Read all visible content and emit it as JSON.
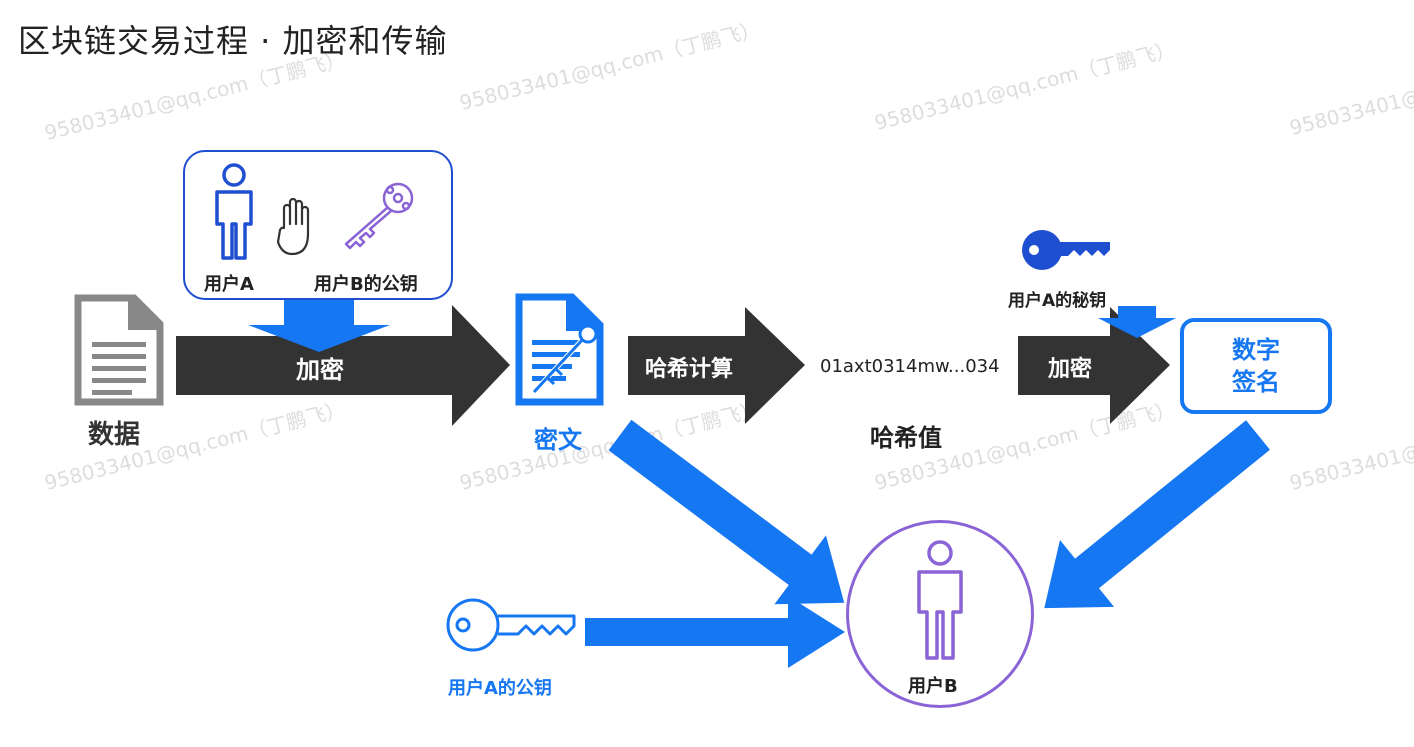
{
  "title": "区块链交易过程 · 加密和传输",
  "watermark": "958033401@qq.com（丁鹏飞）",
  "labels": {
    "data": "数据",
    "user_a": "用户A",
    "user_b_pubkey": "用户B的公钥",
    "encrypt_1": "加密",
    "ciphertext": "密文",
    "hash_calc": "哈希计算",
    "hash_text": "01axt0314mw...034",
    "hash_value": "哈希值",
    "user_a_privkey": "用户A的秘钥",
    "encrypt_2": "加密",
    "signature_line1": "数字",
    "signature_line2": "签名",
    "user_a_pubkey": "用户A的公钥",
    "user_b": "用户B"
  },
  "colors": {
    "dark_arrow": "#333333",
    "blue_arrow": "#1677f2",
    "deep_blue": "#1f4fd1",
    "purple": "#8a64d6",
    "gray_doc": "#888888"
  },
  "icons": [
    "document-icon",
    "person-icon",
    "hand-icon",
    "key-icon",
    "ciphertext-icon"
  ]
}
